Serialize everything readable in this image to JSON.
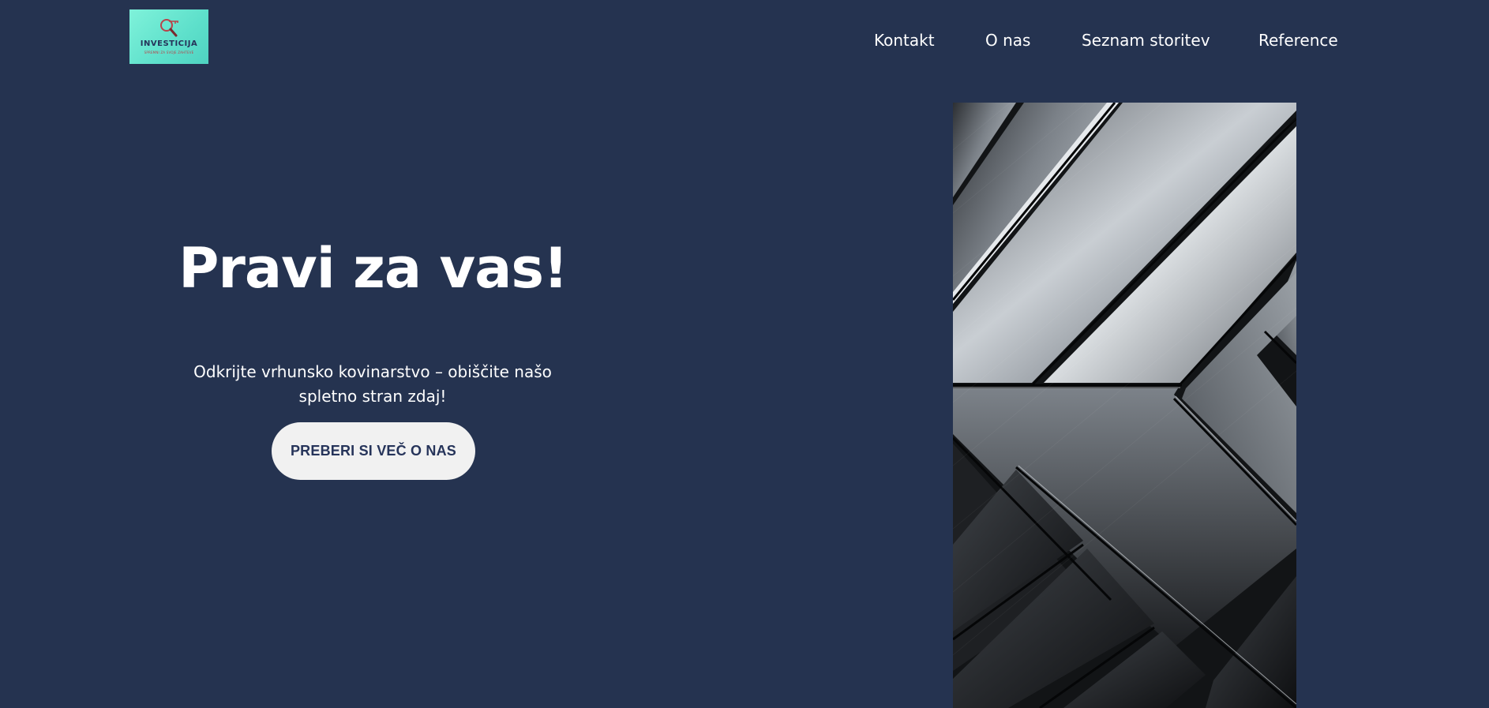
{
  "page": {
    "background": "#253350",
    "text_color": "#ffffff"
  },
  "logo": {
    "title": "INVESTICIJA",
    "tagline": "SPREMNI ZA SVOJE ZAHTEVE",
    "icon": "magnifier-key-icon",
    "background": "#6ee8d2"
  },
  "nav": {
    "items": [
      {
        "label": "Kontakt"
      },
      {
        "label": "O nas"
      },
      {
        "label": "Seznam storitev"
      },
      {
        "label": "Reference"
      }
    ]
  },
  "hero": {
    "title": "Pravi za vas!",
    "subtitle": "Odkrijte vrhunsko kovinarstvo – obiščite našo spletno stran zdaj!",
    "cta_label": "PREBERI SI VEČ O NAS",
    "cta_background": "#f1f1f1",
    "cta_text_color": "#26345a",
    "image": "brushed-metal-panels-image"
  }
}
